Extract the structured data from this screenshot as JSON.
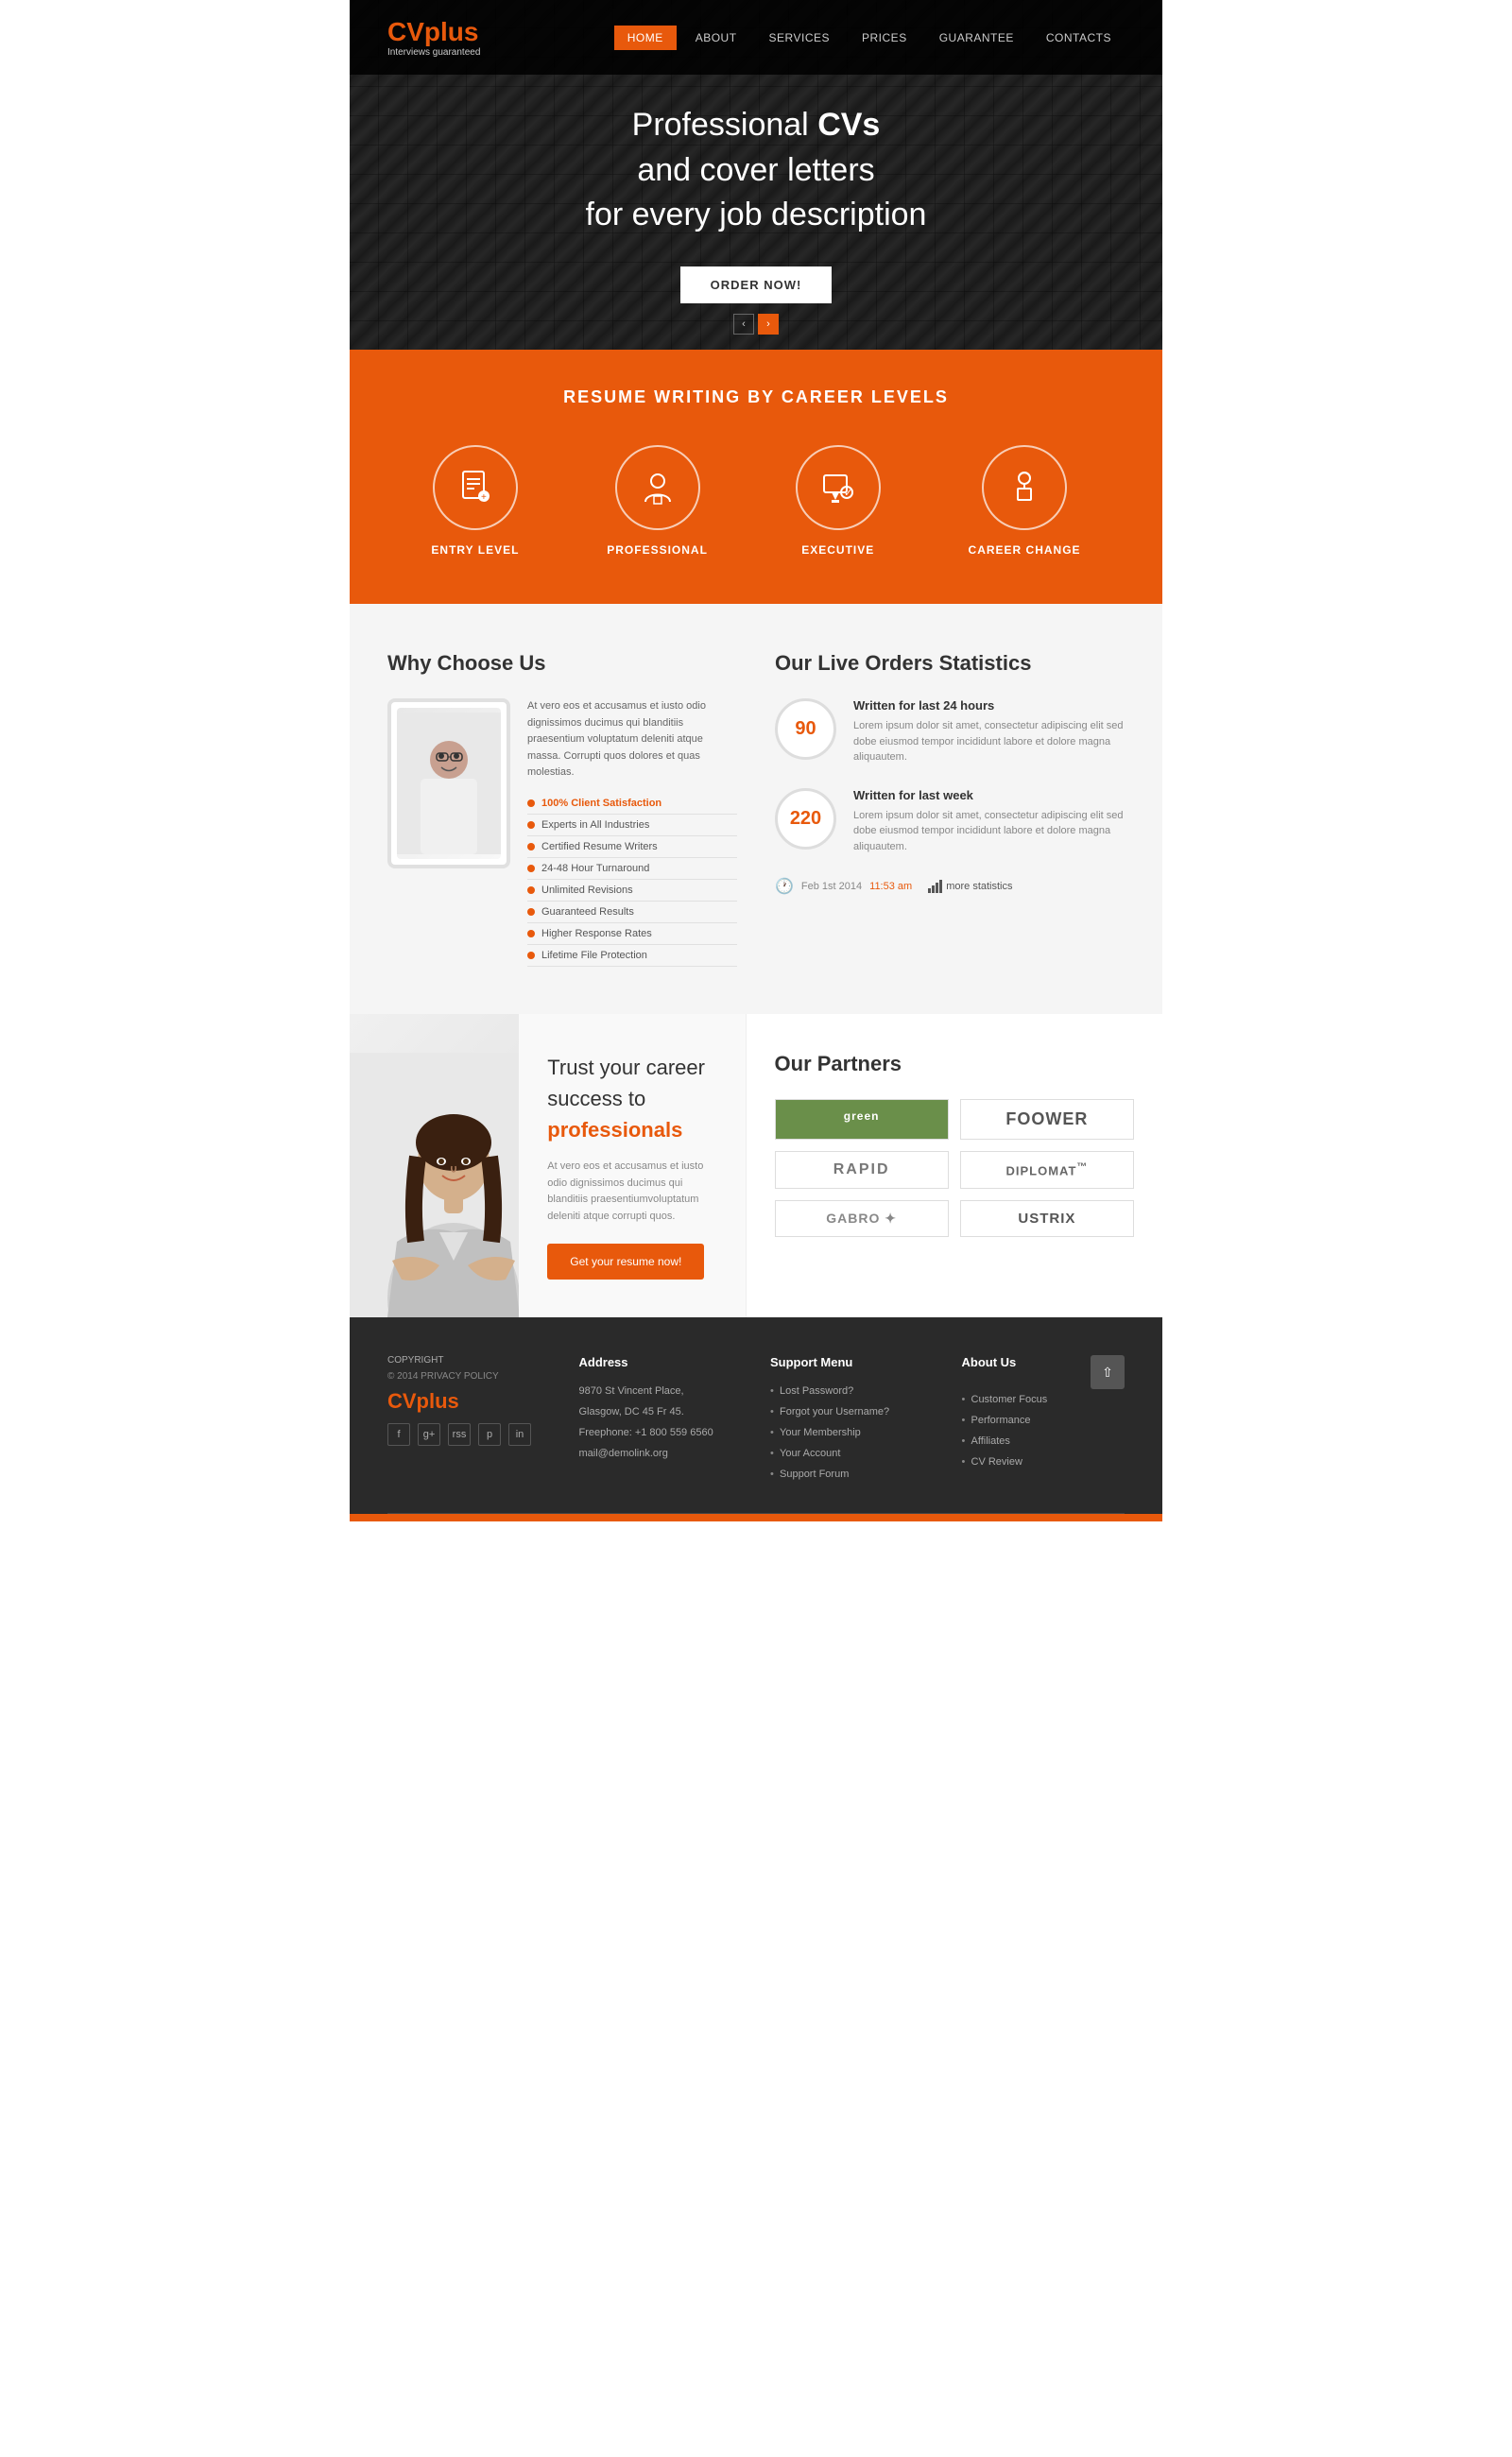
{
  "site": {
    "logo_cv": "CV",
    "logo_plus": "plus",
    "logo_tagline": "Interviews guaranteed"
  },
  "nav": {
    "items": [
      {
        "label": "HOME",
        "active": true
      },
      {
        "label": "ABOUT",
        "active": false
      },
      {
        "label": "SERVICES",
        "active": false
      },
      {
        "label": "PRICES",
        "active": false
      },
      {
        "label": "GUARANTEE",
        "active": false
      },
      {
        "label": "CONTACTS",
        "active": false
      }
    ]
  },
  "hero": {
    "title_part1": "Professional ",
    "title_bold": "CVs",
    "title_part2": "and cover letters",
    "title_part3": "for every job description",
    "button_label": "ORDER NOW!"
  },
  "career_section": {
    "title": "RESUME WRITING BY CAREER LEVELS",
    "items": [
      {
        "label": "ENTRY LEVEL",
        "icon": "📄"
      },
      {
        "label": "PROFESSIONAL",
        "icon": "👤"
      },
      {
        "label": "EXECUTIVE",
        "icon": "💬"
      },
      {
        "label": "CAREER CHANGE",
        "icon": "🍎"
      }
    ]
  },
  "why_choose": {
    "title": "Why Choose Us",
    "description": "At vero eos et accusamus et iusto odio dignissimos ducimus qui blanditiis praesentium voluptatum deleniti atque massa. Corrupti quos dolores et quas molestias.",
    "list": [
      "100% Client Satisfaction",
      "Experts in All Industries",
      "Certified Resume Writers",
      "24-48 Hour Turnaround",
      "Unlimited Revisions",
      "Guaranteed Results",
      "Higher Response Rates",
      "Lifetime File Protection"
    ]
  },
  "stats": {
    "title": "Our Live Orders Statistics",
    "stat1": {
      "number": "90",
      "label": "Written for last 24 hours",
      "desc": "Lorem ipsum dolor sit amet, consectetur adipiscing elit sed dobe eiusmod tempor incididunt labore et dolore magna aliquautem."
    },
    "stat2": {
      "number": "220",
      "label": "Written for last week",
      "desc": "Lorem ipsum dolor sit amet, consectetur adipiscing elit sed dobe eiusmod tempor incididunt labore et dolore magna aliquautem."
    },
    "date": "Feb 1st 2014",
    "time": "11:53 am",
    "more_stats": "more statistics"
  },
  "trust": {
    "title": "Trust your career",
    "title2": "success to",
    "highlight": "professionals",
    "desc": "At vero eos et accusamus et iusto odio dignissimos ducimus qui blanditiis praesentiumvoluptatum deleniti atque corrupti quos.",
    "button": "Get your resume now!"
  },
  "partners": {
    "title": "Our Partners",
    "logos": [
      {
        "name": "green",
        "style": "green"
      },
      {
        "name": "FOOWER",
        "style": "normal"
      },
      {
        "name": "RAPID",
        "style": "normal"
      },
      {
        "name": "DIPLOMAT",
        "style": "normal"
      },
      {
        "name": "GABRO",
        "style": "normal"
      },
      {
        "name": "USTRIX",
        "style": "normal"
      }
    ]
  },
  "footer": {
    "copyright": "COPYRIGHT",
    "year": "© 2014 PRIVACY POLICY",
    "logo": "CVplus",
    "address_title": "Address",
    "address_lines": [
      "9870 St Vincent Place,",
      "Glasgow, DC 45 Fr 45.",
      "Freephone: +1 800 559 6560",
      "mail@demolink.org"
    ],
    "support_title": "Support Menu",
    "support_links": [
      "Lost Password?",
      "Forgot your Username?",
      "Your Membership",
      "Your Account",
      "Support Forum"
    ],
    "about_title": "About Us",
    "about_links": [
      "Customer Focus",
      "Performance",
      "Affiliates",
      "CV Review"
    ],
    "social": [
      "f",
      "g+",
      "rss",
      "p",
      "in"
    ]
  }
}
